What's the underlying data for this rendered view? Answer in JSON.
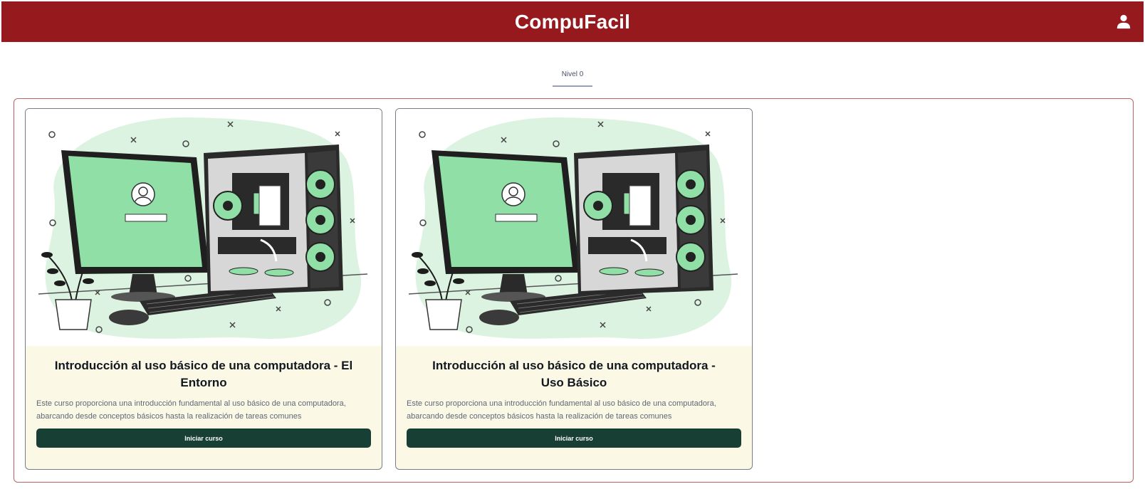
{
  "header": {
    "brand": "CompuFacil",
    "user_icon": "user-icon",
    "background_color": "#961a1d"
  },
  "tabs": [
    {
      "label": "Nivel 0",
      "active": true
    }
  ],
  "courses": [
    {
      "title": "Introducción al uso básico de una computadora - El Entorno",
      "description": "Este curso proporciona una introducción fundamental al uso básico de una computadora, abarcando desde conceptos básicos hasta la realización de tareas comunes",
      "button_label": "Iniciar curso"
    },
    {
      "title": "Introducción al uso básico de una computadora - Uso Básico",
      "description": "Este curso proporciona una introducción fundamental al uso básico de una computadora, abarcando desde conceptos básicos hasta la realización de tareas comunes",
      "button_label": "Iniciar curso"
    }
  ],
  "colors": {
    "accent_red": "#961a1d",
    "button_green": "#173f34",
    "illustration_green": "#8fdfa6",
    "card_body": "#fcf8e6"
  }
}
